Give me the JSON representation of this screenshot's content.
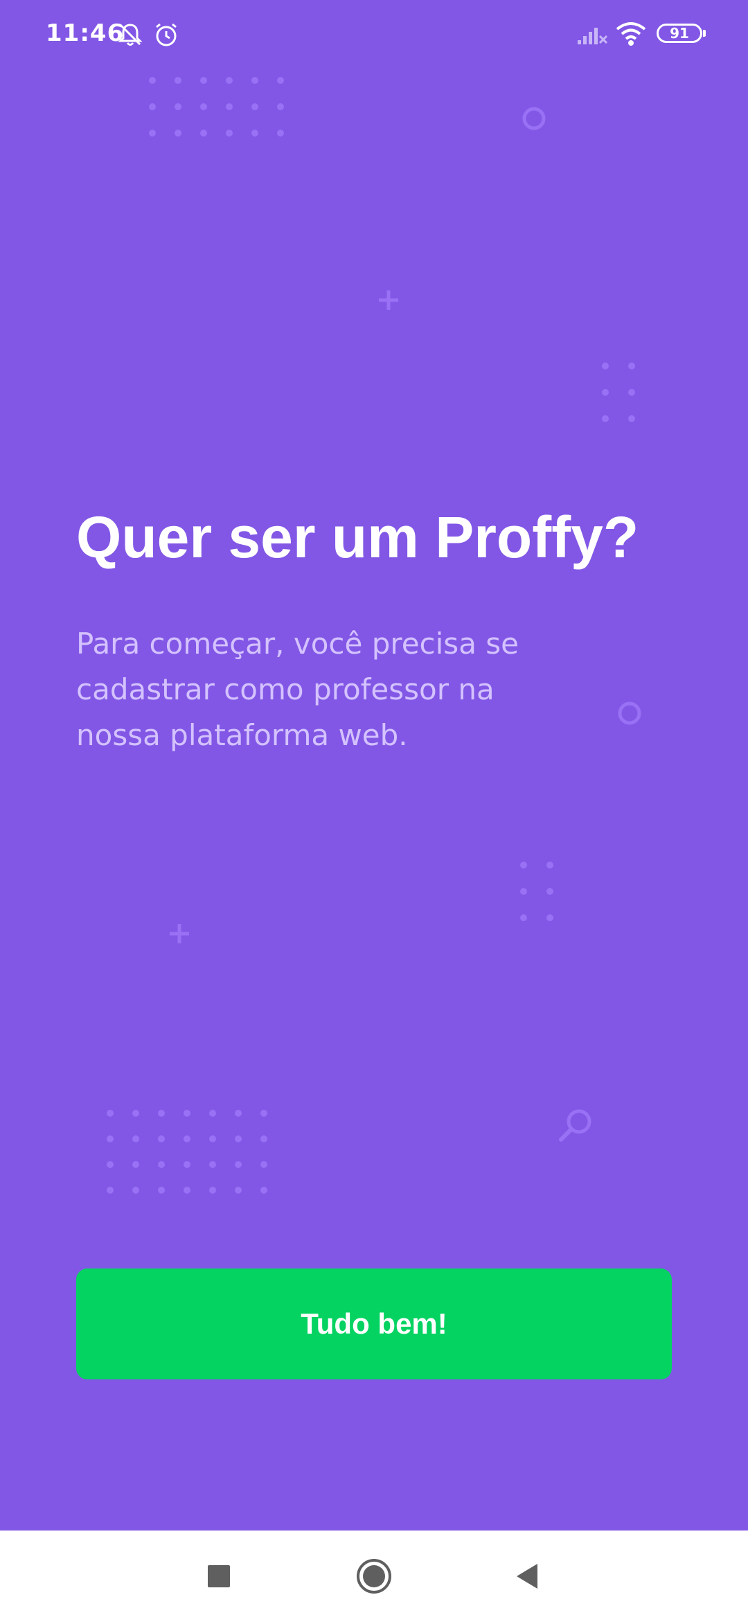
{
  "status_bar": {
    "time": "11:46",
    "battery_level": "91",
    "icons": [
      "notifications-off-icon",
      "alarm-icon",
      "signal-icon",
      "wifi-icon",
      "battery-icon"
    ]
  },
  "main": {
    "title": "Quer ser um Proffy?",
    "description": "Para começar, você precisa se cadastrar como professor na nossa plataforma web.",
    "ok_button_label": "Tudo bem!"
  },
  "nav_bar": {
    "buttons": [
      "recents-square-icon",
      "home-circle-icon",
      "back-triangle-icon"
    ]
  },
  "colors": {
    "background": "#8257E5",
    "button": "#04D361",
    "title_text": "#FFFFFF",
    "description_text": "#D4C2FF",
    "decoration": "#9871F5",
    "nav_background": "#FFFFFF"
  }
}
